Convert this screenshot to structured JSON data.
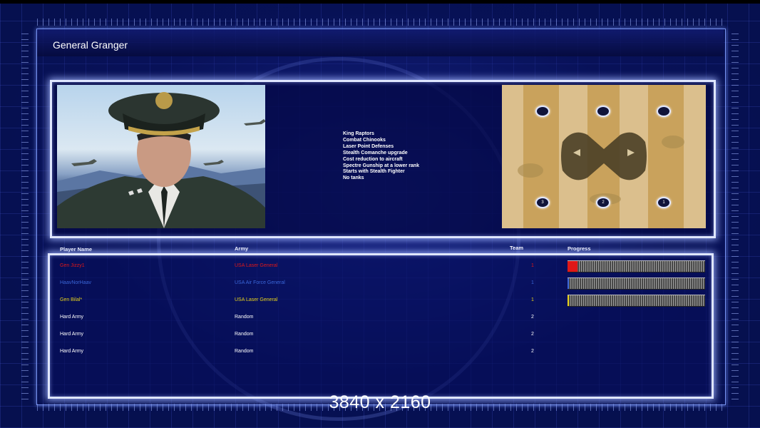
{
  "title": "General Granger",
  "features": [
    "King Raptors",
    "Combat Chinooks",
    "Laser Point Defenses",
    "Stealth Comanche upgrade",
    "Cost reduction to aircraft",
    "Spectre Gunship at a lower rank",
    "Starts with Stealth Fighter",
    "No tanks"
  ],
  "table": {
    "headers": {
      "player": "Player Name",
      "army": "Army",
      "team": "Team",
      "progress": "Progress"
    },
    "rows": [
      {
        "name": "Gen Jizzy1",
        "army": "USA Laser General",
        "team": "1",
        "color": "#e01818",
        "progress": 0.07
      },
      {
        "name": "HaavNorHaav",
        "army": "USA Air Force General",
        "team": "1",
        "color": "#3a66d8",
        "progress": 0.01
      },
      {
        "name": "Gen Bilal*",
        "army": "USA Laser General",
        "team": "1",
        "color": "#e6d21a",
        "progress": 0.01
      },
      {
        "name": "Hard Army",
        "army": "Random",
        "team": "2",
        "color": "#ffffff",
        "progress": null
      },
      {
        "name": "Hard Army",
        "army": "Random",
        "team": "2",
        "color": "#ffffff",
        "progress": null
      },
      {
        "name": "Hard Army",
        "army": "Random",
        "team": "2",
        "color": "#ffffff",
        "progress": null
      }
    ]
  },
  "map": {
    "start_positions": [
      "",
      "",
      "",
      "3",
      "2",
      "1"
    ]
  },
  "resolution_label": "3840 x 2160"
}
